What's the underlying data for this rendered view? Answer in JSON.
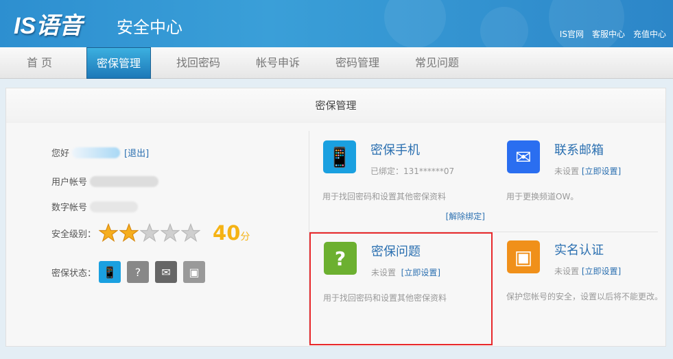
{
  "header": {
    "logo": "IS语音",
    "subtitle": "安全中心",
    "links": [
      "IS官网",
      "客服中心",
      "充值中心"
    ]
  },
  "nav": {
    "tabs": [
      "首 页",
      "密保管理",
      "找回密码",
      "帐号申诉",
      "密码管理",
      "常见问题"
    ],
    "active": 1
  },
  "panel": {
    "title": "密保管理"
  },
  "user": {
    "greeting": "您好",
    "logout": "[退出]",
    "account_label": "用户帐号",
    "number_label": "数字帐号",
    "level_label": "安全级别：",
    "stars_filled": 2,
    "stars_total": 5,
    "score": "40",
    "score_unit": "分",
    "status_label": "密保状态："
  },
  "cards": [
    {
      "title": "密保手机",
      "status": "已绑定：131******07",
      "action": "",
      "desc": "用于找回密码和设置其他密保资料",
      "extra": "[解除绑定]",
      "color": "#1aa0e0"
    },
    {
      "title": "联系邮箱",
      "status": "未设置",
      "action": "[立即设置]",
      "desc": "用于更换频道OW。",
      "extra": "",
      "color": "#2a6ef0"
    },
    {
      "title": "密保问题",
      "status": "未设置",
      "action": "[立即设置]",
      "desc": "用于找回密码和设置其他密保资料",
      "extra": "",
      "color": "#6cb030"
    },
    {
      "title": "实名认证",
      "status": "未设置",
      "action": "[立即设置]",
      "desc": "保护您帐号的安全，设置以后将不能更改。",
      "extra": "",
      "color": "#f0901a"
    }
  ]
}
